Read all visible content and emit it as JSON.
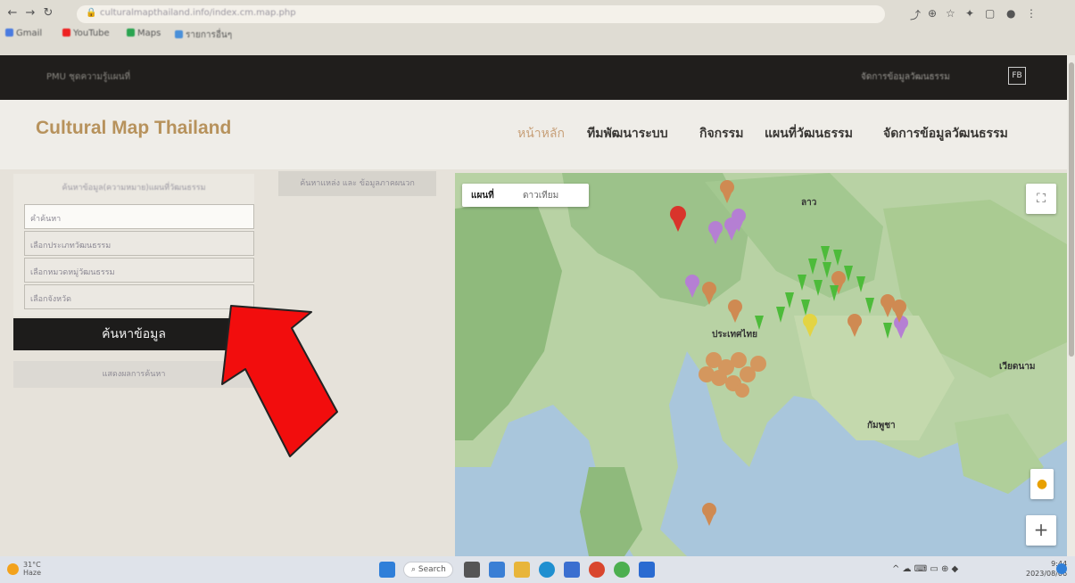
{
  "browser": {
    "url": "culturalmapthailand.info/index.cm.map.php",
    "bookmarks": [
      {
        "label": "Gmail",
        "color": "#4a7be0"
      },
      {
        "label": "YouTube",
        "color": "#e22"
      },
      {
        "label": "Maps",
        "color": "#2aa450"
      },
      {
        "label": "รายการอื่นๆ",
        "color": "#4a90d9"
      }
    ]
  },
  "topbar": {
    "left_text": "PMU ชุดความรู้แผนที่",
    "right_text": "จัดการข้อมูลวัฒนธรรม",
    "social": "FB"
  },
  "header": {
    "logo": "Cultural Map Thailand",
    "menu": [
      {
        "label": "หน้าหลัก",
        "active": true
      },
      {
        "label": "ทีมพัฒนาระบบ",
        "active": false
      },
      {
        "label": "กิจกรรม",
        "active": false
      },
      {
        "label": "แผนที่วัฒนธรรม",
        "active": false
      },
      {
        "label": "จัดการข้อมูลวัฒนธรรม",
        "active": false
      }
    ]
  },
  "sidebar": {
    "title": "ค้นหาข้อมูล(ความหมาย)แผนที่วัฒนธรรม",
    "fields": [
      {
        "value": "คำค้นหา"
      },
      {
        "value": "เลือกประเภทวัฒนธรรม"
      },
      {
        "value": "เลือกหมวดหมู่วัฒนธรรม"
      },
      {
        "value": "เลือกจังหวัด"
      }
    ],
    "search_button": "ค้นหาข้อมูล",
    "advanced_button": "แสดงผลการค้นหา"
  },
  "tab_pill": "ค้นหาแหล่ง และ ข้อมูลภาคผนวก",
  "map": {
    "type_map": "แผนที่",
    "type_satellite": "ดาวเทียม",
    "labels": [
      {
        "text": "ลาว"
      },
      {
        "text": "ประเทศไทย"
      },
      {
        "text": "เวียดนาม"
      },
      {
        "text": "กัมพูชา"
      }
    ],
    "zoom_in": "+",
    "fullscreen_icon": "⛶"
  },
  "taskbar": {
    "weather_temp": "31°C",
    "weather_desc": "Haze",
    "search_label": "Search",
    "time": "9:44",
    "date": "2023/08/06"
  }
}
